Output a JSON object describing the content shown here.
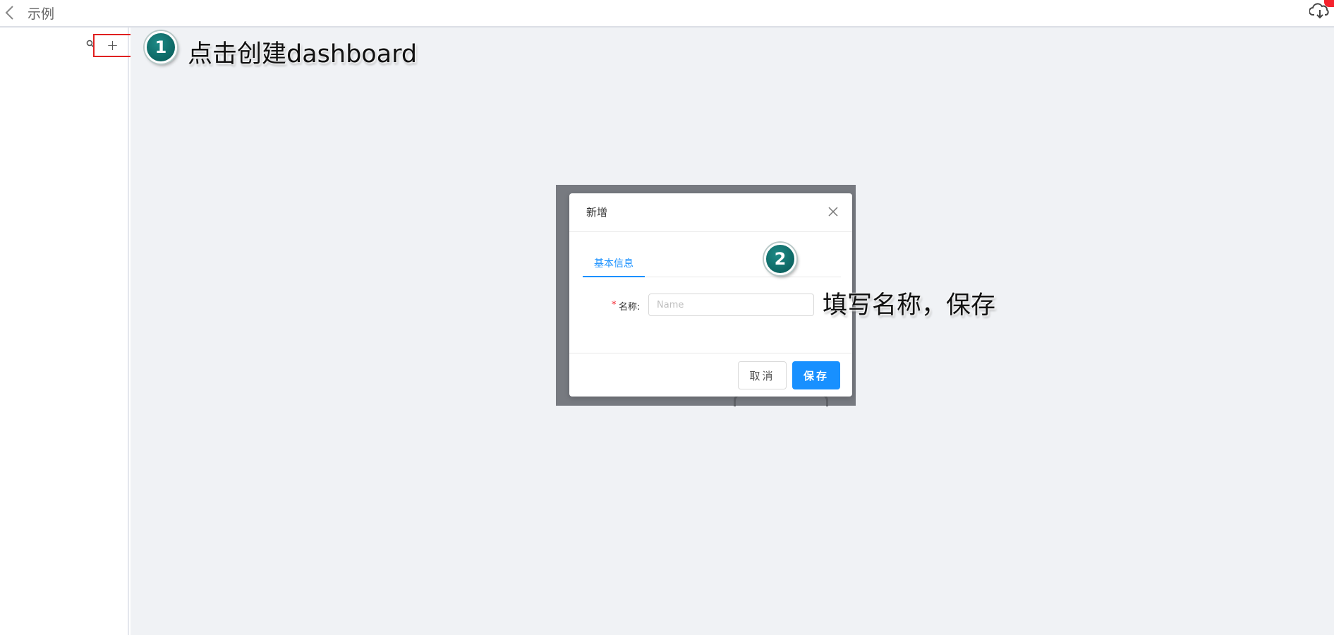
{
  "header": {
    "title": "示例",
    "back_icon": "chevron-left-icon",
    "cloud_icon": "cloud-download-icon"
  },
  "sidebar": {
    "search_icon": "search-icon",
    "add_label": "+"
  },
  "annotations": [
    {
      "number": "1",
      "text": "点击创建dashboard"
    },
    {
      "number": "2",
      "text": "填写名称，保存"
    }
  ],
  "modal": {
    "title": "新增",
    "tabs": [
      {
        "label": "基本信息",
        "active": true
      }
    ],
    "fields": [
      {
        "label": "名称:",
        "required": true,
        "value": "",
        "placeholder": "Name"
      }
    ],
    "buttons": {
      "cancel": "取消",
      "save": "保存"
    }
  },
  "colors": {
    "primary": "#1890ff",
    "highlight_box": "#e02020",
    "step_badge": "#0d6663",
    "badge_red": "#f5222d"
  }
}
